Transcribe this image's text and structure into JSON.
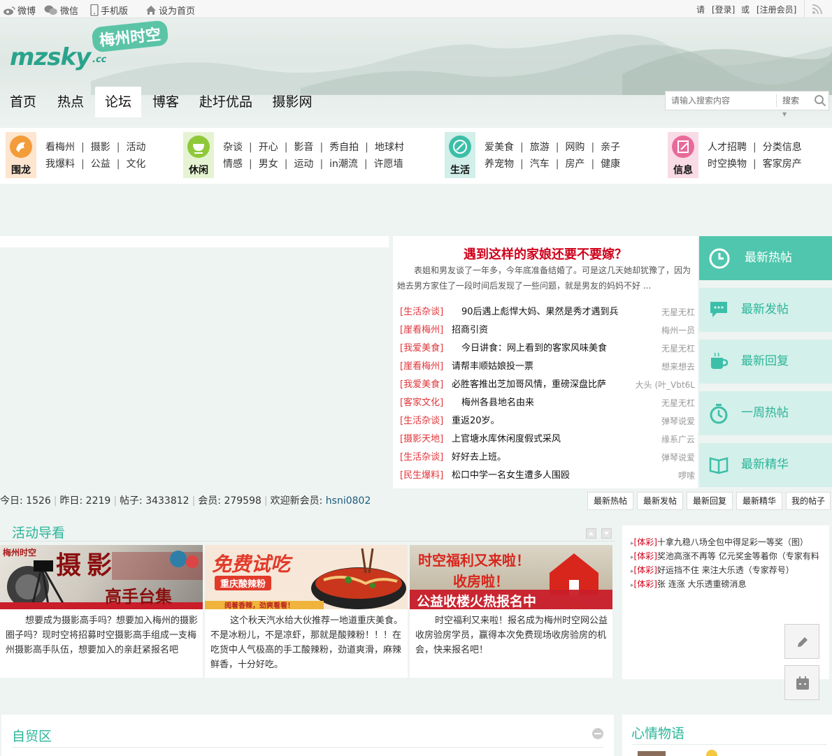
{
  "topbar": {
    "weibo": "微博",
    "weixin": "微信",
    "mobile": "手机版",
    "homepage": "设为首页",
    "please": "请",
    "login": "[登录]",
    "or": "或",
    "register": "[注册会员]"
  },
  "logo": {
    "text": "mzsky",
    "suffix": ".cc",
    "badge": "梅州时空"
  },
  "nav": {
    "items": [
      "首页",
      "热点",
      "论坛",
      "博客",
      "赴圩优品",
      "摄影网"
    ],
    "active": "论坛"
  },
  "search": {
    "placeholder": "请输入搜索内容",
    "button": "搜索"
  },
  "categories": [
    {
      "label": "围龙",
      "color": "#f39c3a",
      "row1": [
        "看梅州",
        "摄影",
        "活动"
      ],
      "row2": [
        "我爆料",
        "公益",
        "文化"
      ]
    },
    {
      "label": "休闲",
      "color": "#8fc93a",
      "row1": [
        "杂谈",
        "开心",
        "影音",
        "秀自拍",
        "地球村"
      ],
      "row2": [
        "情感",
        "男女",
        "运动",
        "in潮流",
        "许愿墙"
      ]
    },
    {
      "label": "生活",
      "color": "#3cbfa8",
      "row1": [
        "爱美食",
        "旅游",
        "网购",
        "亲子"
      ],
      "row2": [
        "养宠物",
        "汽车",
        "房产",
        "健康"
      ]
    },
    {
      "label": "信息",
      "color": "#e86a9a",
      "row1": [
        "人才招聘",
        "分类信息"
      ],
      "row2": [
        "时空换物",
        "客家房产"
      ]
    }
  ],
  "headline": {
    "title": "遇到这样的家娘还要不要嫁？",
    "summary": "表姐和男友谈了一年多，今年底准备结婚了。可是这几天她却犹豫了，因为她去男方家住了一段时间后发现了一些问题，就是男友的妈妈不好 ..."
  },
  "posts": [
    {
      "category": "[生活杂谈]",
      "title": "90后遇上彪悍大妈、果然是秀才遇到兵",
      "author": "无星无杠"
    },
    {
      "category": "[崖看梅州]",
      "title": "招商引资",
      "author": "梅州一员"
    },
    {
      "category": "[我爱美食]",
      "title": "今日讲食：网上看到的客家风味美食",
      "author": "无星无杠"
    },
    {
      "category": "[崖看梅州]",
      "title": "请帮丰顺姑娘投一票",
      "author": "想来想去"
    },
    {
      "category": "[我爱美食]",
      "title": "必胜客推出芝加哥风情，重磅深盘比萨",
      "author": "大头 (叶_Vbt6L"
    },
    {
      "category": "[客家文化]",
      "title": "梅州各县地名由来",
      "author": "无星无杠"
    },
    {
      "category": "[生活杂谈]",
      "title": "重返20岁。",
      "author": "弹琴说爱"
    },
    {
      "category": "[摄影天地]",
      "title": "上官塘水库休闲度假式采风",
      "author": "缘系广云"
    },
    {
      "category": "[生活杂谈]",
      "title": "好好去上班。",
      "author": "弹琴说爱"
    },
    {
      "category": "[民生爆料]",
      "title": "松口中学一名女生遭多人围殴",
      "author": "啰嗦"
    }
  ],
  "right_tabs": [
    {
      "label": "最新热帖",
      "icon": "clock-icon"
    },
    {
      "label": "最新发帖",
      "icon": "chat-icon"
    },
    {
      "label": "最新回复",
      "icon": "cup-icon"
    },
    {
      "label": "一周热帖",
      "icon": "stopwatch-icon"
    },
    {
      "label": "最新精华",
      "icon": "book-icon"
    }
  ],
  "stats": {
    "today": "今日: 1526",
    "yesterday": "昨日: 2219",
    "posts": "帖子: 3433812",
    "members": "会员: 279598",
    "welcome": "欢迎新会员:",
    "newest": "hsni0802"
  },
  "quick_buttons": [
    "最新热帖",
    "最新发帖",
    "最新回复",
    "最新精华",
    "我的帖子"
  ],
  "activity": {
    "title": "活动导看",
    "items": [
      {
        "banner_left": "梅州时空",
        "banner_main": "摄影",
        "banner_sub": "高手台集",
        "desc": "想要成为摄影高手吗？想要加入梅州的摄影圈子吗？现时空将招募时空摄影高手组成一支梅州摄影高手队伍，想要加入的亲赶紧报名吧"
      },
      {
        "banner_main": "免费试吃",
        "banner_sub": "重庆酸辣粉",
        "banner_foot": "阅着香辣，劲爽看看！",
        "desc": "这个秋天汽水给大伙推荐一地道重庆美食。不是冰粉儿，不是凉虾，那就是酸辣粉！！！在吃货中人气极高的手工酸辣粉，劲道爽滑，麻辣鲜香，十分好吃。"
      },
      {
        "banner_main": "时空福利又来啦！",
        "banner_sub": "收房啦！",
        "banner_foot": "公益收楼火热报名中",
        "desc": "时空福利又来啦！报名成为梅州时空网公益收房验房学员，赢得本次免费现场收房验房的机会，快来报名吧！"
      }
    ]
  },
  "lottery": [
    {
      "cat": "[体彩]",
      "text": "十拿九稳八场全包中得足彩一等奖（图）"
    },
    {
      "cat": "[体彩]",
      "text": "奖池高涨不再等 亿元奖金等着你（专家有料"
    },
    {
      "cat": "[体彩]",
      "text": "好运挡不住 来注大乐透（专家荐号）"
    },
    {
      "cat": "[体彩]",
      "text": "张 连涨 大乐透重磅消息"
    }
  ],
  "bottom": {
    "left_title": "自贸区",
    "right_title": "心情物语"
  },
  "colors": {
    "accent": "#2bb59a",
    "tab_active": "#4fc6ad",
    "tab_bg": "#d4f0ea",
    "headline": "#d0021b",
    "post_category": "#e0363b"
  }
}
